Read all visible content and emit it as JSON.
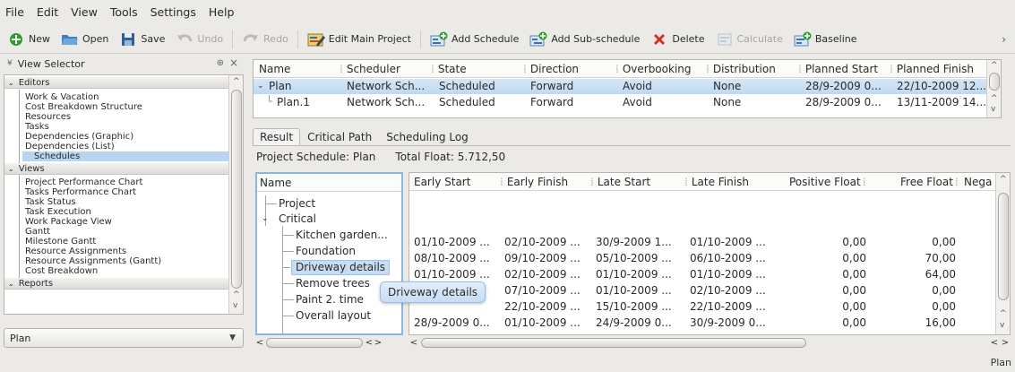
{
  "menu": [
    "File",
    "Edit",
    "View",
    "Tools",
    "Settings",
    "Help"
  ],
  "toolbar": {
    "new": "New",
    "open": "Open",
    "save": "Save",
    "undo": "Undo",
    "redo": "Redo",
    "edit_main": "Edit Main Project",
    "add_schedule": "Add Schedule",
    "add_sub": "Add Sub-schedule",
    "delete": "Delete",
    "calculate": "Calculate",
    "baseline": "Baseline",
    "more": "›"
  },
  "view_selector": {
    "title": "View Selector",
    "editors_label": "Editors",
    "editors": [
      "Work & Vacation",
      "Cost Breakdown Structure",
      "Resources",
      "Tasks",
      "Dependencies (Graphic)",
      "Dependencies (List)",
      "Schedules"
    ],
    "views_label": "Views",
    "views": [
      "Project Performance Chart",
      "Tasks Performance Chart",
      "Task Status",
      "Task Execution",
      "Work Package View",
      "Gantt",
      "Milestone Gantt",
      "Resource Assignments",
      "Resource Assignments (Gantt)",
      "Cost Breakdown"
    ],
    "reports_label": "Reports",
    "combo_value": "Plan"
  },
  "schedules": {
    "headers": [
      "Name",
      "Scheduler",
      "State",
      "Direction",
      "Overbooking",
      "Distribution",
      "Planned Start",
      "Planned Finish"
    ],
    "rows": [
      {
        "name": "Plan",
        "scheduler": "Network Sch...",
        "state": "Scheduled",
        "direction": "Forward",
        "overbooking": "Avoid",
        "distribution": "None",
        "start": "28/9-2009 0...",
        "finish": "22/10-2009 12..."
      },
      {
        "name": "Plan.1",
        "scheduler": "Network Sch...",
        "state": "Scheduled",
        "direction": "Forward",
        "overbooking": "Avoid",
        "distribution": "None",
        "start": "28/9-2009 0...",
        "finish": "13/11-2009 14..."
      }
    ]
  },
  "tabs": [
    "Result",
    "Critical Path",
    "Scheduling Log"
  ],
  "info": {
    "schedule": "Project Schedule: Plan",
    "float": "Total Float: 5.712,50"
  },
  "result_tree": {
    "header": "Name",
    "project": "Project",
    "critical": "Critical",
    "items": [
      "Kitchen garden...",
      "Foundation",
      "Driveway details",
      "Remove trees",
      "Paint 2. time",
      "Overall layout"
    ]
  },
  "result_grid": {
    "headers": [
      "Early Start",
      "Early Finish",
      "Late Start",
      "Late Finish",
      "Positive Float",
      "Free Float",
      "Nega"
    ],
    "rows": [
      [
        "01/10-2009 ...",
        "02/10-2009 ...",
        "30/9-2009 1...",
        "01/10-2009 ...",
        "0,00",
        "0,00"
      ],
      [
        "08/10-2009 ...",
        "09/10-2009 ...",
        "05/10-2009 ...",
        "06/10-2009 ...",
        "0,00",
        "70,00"
      ],
      [
        "01/10-2009 ...",
        "02/10-2009 ...",
        "01/10-2009 ...",
        "01/10-2009 ...",
        "0,00",
        "64,00"
      ],
      [
        "",
        "07/10-2009 ...",
        "01/10-2009 ...",
        "02/10-2009 ...",
        "0,00",
        "0,00"
      ],
      [
        "",
        "22/10-2009 ...",
        "15/10-2009 ...",
        "22/10-2009 ...",
        "0,00",
        "0,00"
      ],
      [
        "28/9-2009 0...",
        "01/10-2009 ...",
        "24/9-2009 0...",
        "30/9-2009 0...",
        "0,00",
        "16,00"
      ]
    ]
  },
  "tooltip": "Driveway details",
  "status": "Plan"
}
